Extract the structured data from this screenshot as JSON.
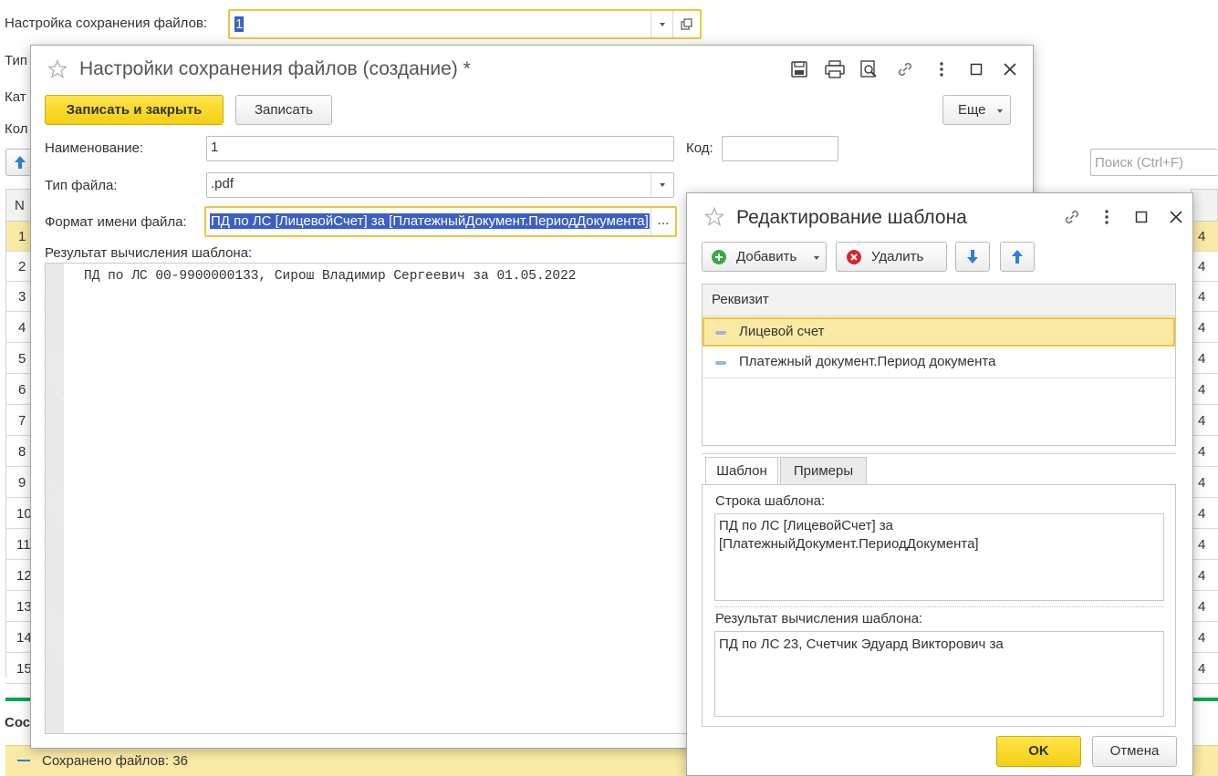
{
  "background": {
    "setting_label": "Настройка сохранения файлов:",
    "setting_value": "1",
    "cut_labels": [
      "Тип",
      "Кат",
      "Кол"
    ],
    "search_placeholder": "Поиск (Ctrl+F)",
    "table_header": "N",
    "row_numbers": [
      "1",
      "2",
      "3",
      "4",
      "5",
      "6",
      "7",
      "8",
      "9",
      "10",
      "11",
      "12",
      "13",
      "14",
      "15"
    ],
    "right_col_value": "4",
    "section_cut": "Сос",
    "saved_status": "Сохранено файлов: 36"
  },
  "main_dialog": {
    "title": "Настройки сохранения файлов (создание) *",
    "save_close_label": "Записать и закрыть",
    "save_label": "Записать",
    "more_label": "Еще",
    "name_label": "Наименование:",
    "name_value": "1",
    "code_label": "Код:",
    "code_value": "",
    "filetype_label": "Тип файла:",
    "filetype_value": ".pdf",
    "format_label": "Формат имени файла:",
    "format_value": "ПД по ЛС [ЛицевойСчет] за [ПлатежныйДокумент.ПериодДокумента]",
    "ellipsis_label": "...",
    "result_label": "Результат вычисления шаблона:",
    "result_value": "ПД по ЛС 00-9900000133, Сирош Владимир Сергеевич за 01.05.2022"
  },
  "template_dialog": {
    "title": "Редактирование шаблона",
    "add_label": "Добавить",
    "delete_label": "Удалить",
    "column_header": "Реквизит",
    "items": [
      "Лицевой счет",
      "Платежный документ.Период документа"
    ],
    "tab_template": "Шаблон",
    "tab_examples": "Примеры",
    "template_string_label": "Строка шаблона:",
    "template_string_line1": "ПД по ЛС [ЛицевойСчет] за",
    "template_string_line2": "[ПлатежныйДокумент.ПериодДокумента]",
    "result_label": "Результат вычисления шаблона:",
    "result_value": "ПД по ЛС 23, Счетчик Эдуард Викторович за",
    "ok_label": "OK",
    "cancel_label": "Отмена"
  },
  "colors": {
    "accent_yellow": "#f5c33b",
    "button_yellow": "#f4cf11",
    "selection_blue": "#3b5fc4",
    "row_highlight": "#fbeaa5",
    "status_green": "#00a651"
  }
}
